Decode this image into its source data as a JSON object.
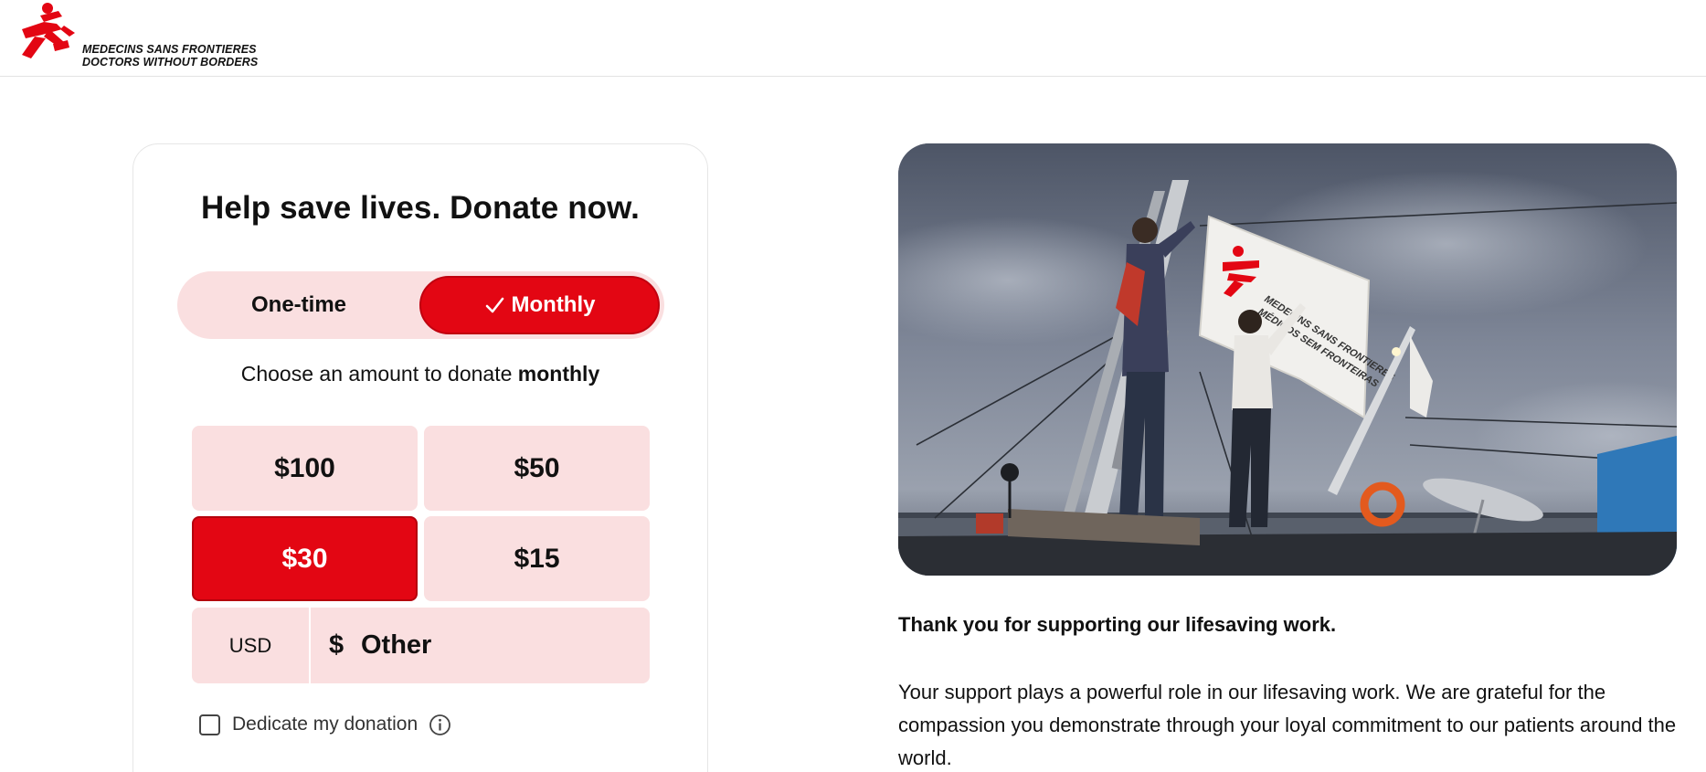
{
  "header": {
    "logo": {
      "icon": "msf-running-man-logo",
      "line1": "MEDECINS SANS FRONTIERES",
      "line2": "DOCTORS WITHOUT BORDERS",
      "brand_color": "#e30613"
    }
  },
  "donation_form": {
    "title": "Help save lives. Donate now.",
    "frequency": {
      "options": [
        "One-time",
        "Monthly"
      ],
      "selected": "Monthly",
      "check_icon": "checkmark-icon"
    },
    "choose_prefix": "Choose an amount to donate",
    "choose_frequency": "monthly",
    "amounts": [
      "$100",
      "$50",
      "$30",
      "$15"
    ],
    "selected_amount": "$30",
    "other": {
      "currency": "USD",
      "symbol": "$",
      "placeholder": "Other"
    },
    "dedicate_label": "Dedicate my donation",
    "dedicate_checked": false,
    "info_icon": "info-icon"
  },
  "side": {
    "photo_alt": "Two people raising an MSF flag on a boat under a cloudy sky",
    "flag_text_line1": "MEDECINS SANS FRONTIERES",
    "flag_text_line2": "MÉDICOS SEM FRONTEIRAS",
    "thanks": "Thank you for supporting our lifesaving work.",
    "support_text": "Your support plays a powerful role in our lifesaving work. We are grateful for the compassion you demonstrate through your loyal commitment to our patients around the world."
  },
  "colors": {
    "accent": "#e30613",
    "pink_bg": "#fadfe0"
  }
}
